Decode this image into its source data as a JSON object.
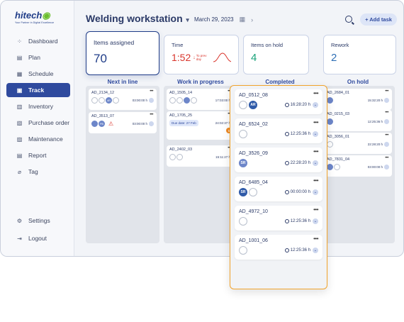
{
  "brand": {
    "name_part1": "hitech",
    "name_part2": "",
    "tagline": "Your Partner in Digital Excellence"
  },
  "sidebar": {
    "items": [
      {
        "label": "Dashboard",
        "icon": "grid-icon"
      },
      {
        "label": "Plan",
        "icon": "plan-icon"
      },
      {
        "label": "Schedule",
        "icon": "schedule-icon"
      },
      {
        "label": "Track",
        "icon": "track-icon",
        "active": true
      },
      {
        "label": "Inventory",
        "icon": "inventory-icon"
      },
      {
        "label": "Purchase order",
        "icon": "purchase-order-icon"
      },
      {
        "label": "Maintenance",
        "icon": "maintenance-icon"
      },
      {
        "label": "Report",
        "icon": "report-icon"
      },
      {
        "label": "Tag",
        "icon": "tag-icon"
      }
    ],
    "bottom": [
      {
        "label": "Settings",
        "icon": "gear-icon"
      },
      {
        "label": "Logout",
        "icon": "logout-icon"
      }
    ]
  },
  "header": {
    "title": "Welding workstation",
    "date": "March 29, 2023",
    "add_task": "+ Add task"
  },
  "stats": {
    "assigned": {
      "label": "Items assigned",
      "value": "70"
    },
    "time": {
      "label": "Time",
      "value": "1:52",
      "note": "To prev day"
    },
    "on_hold": {
      "label": "Items on hold",
      "value": "4"
    },
    "rework": {
      "label": "Rework",
      "value": "2"
    }
  },
  "columns": {
    "next": {
      "title": "Next in line",
      "cards": [
        {
          "id": "AD_2134_12",
          "time": "03:00:00 h",
          "avatar": "AR"
        },
        {
          "id": "AD_3513_07",
          "time": "03:00:00 h",
          "avatar": "PB"
        }
      ]
    },
    "progress": {
      "title": "Work in progress",
      "cards": [
        {
          "id": "AD_1505_14",
          "time": "17:03:00 h"
        },
        {
          "id": "AD_1705_25",
          "time": "24:02:37 h",
          "due": "Due date: 27 Feb",
          "badge": "5"
        },
        {
          "id": "AD_2402_03",
          "time": "15:11:27 h"
        }
      ]
    },
    "completed": {
      "title": "Completed",
      "cards": [
        {
          "id": "AD_0512_08",
          "time": "16:28:20 h",
          "avatar": "AR"
        },
        {
          "id": "AD_6524_02",
          "time": "12:25:36 h"
        },
        {
          "id": "AD_3526_09",
          "time": "22:28:20 h",
          "avatar": "SR"
        },
        {
          "id": "AD_6485_04",
          "time": "00:00:00 h",
          "avatar": "SR"
        },
        {
          "id": "AD_4972_10",
          "time": "12:25:36 h"
        },
        {
          "id": "AD_1001_06",
          "time": "12:25:36 h"
        }
      ]
    },
    "hold": {
      "title": "On hold",
      "cards": [
        {
          "id": "AD_2684_01",
          "time": "15:32:20 h"
        },
        {
          "id": "AD_0215_03",
          "time": "12:25:36 h"
        },
        {
          "id": "AD_3056_01",
          "time": "22:28:20 h"
        },
        {
          "id": "AD_7831_04",
          "time": "03:00:00 h"
        }
      ]
    }
  },
  "colors": {
    "accent": "#2f4a9e",
    "highlight": "#f0a32c",
    "alert": "#d9342b",
    "success": "#1aa37a"
  }
}
